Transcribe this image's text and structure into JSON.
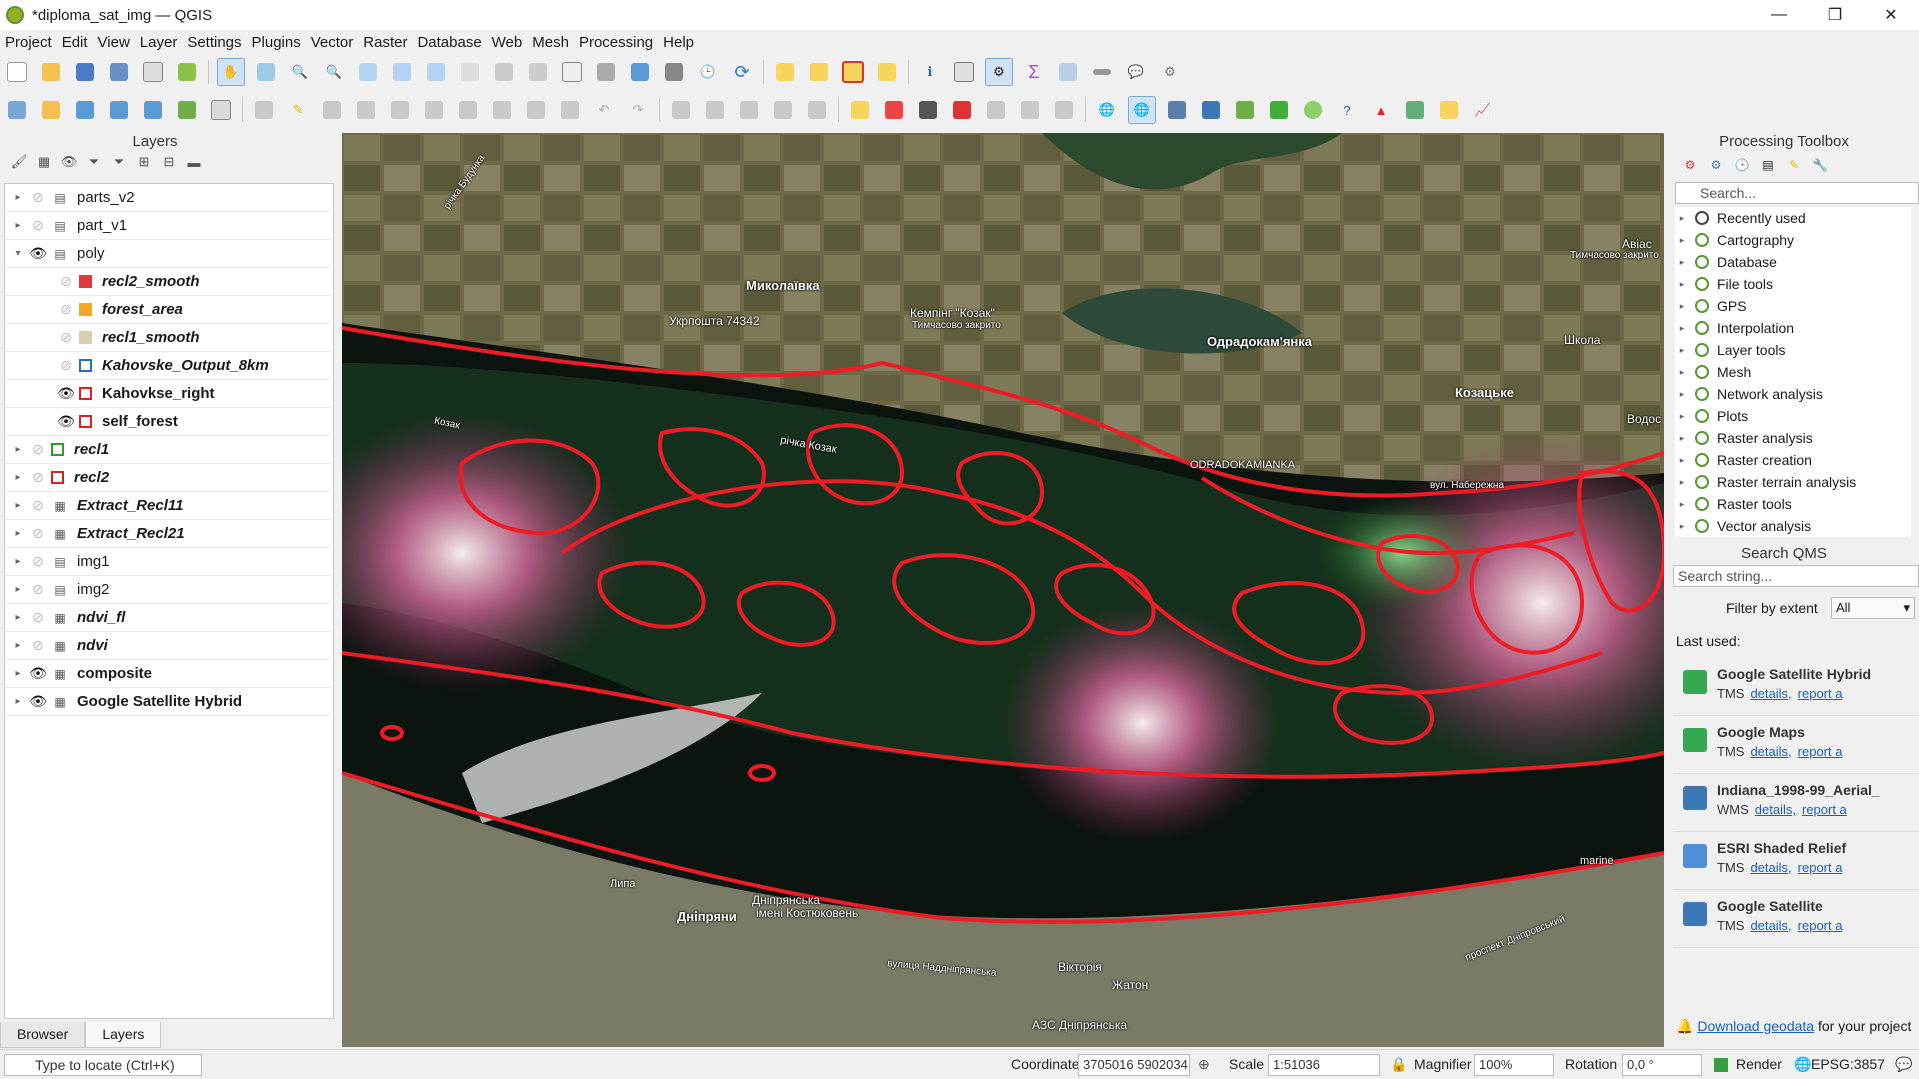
{
  "window": {
    "title": "*diploma_sat_img — QGIS"
  },
  "menu": [
    "Project",
    "Edit",
    "View",
    "Layer",
    "Settings",
    "Plugins",
    "Vector",
    "Raster",
    "Database",
    "Web",
    "Mesh",
    "Processing",
    "Help"
  ],
  "layers_panel": {
    "title": "Layers",
    "items": [
      {
        "name": "parts_v2",
        "visible": false,
        "style": "plain",
        "kind": "group"
      },
      {
        "name": "part_v1",
        "visible": false,
        "style": "plain",
        "kind": "group"
      },
      {
        "name": "poly",
        "visible": true,
        "style": "plain",
        "kind": "group"
      },
      {
        "name": "recl2_smooth",
        "visible": false,
        "style": "bi",
        "kind": "vector",
        "color": "#e03a3a",
        "fill": true
      },
      {
        "name": "forest_area",
        "visible": false,
        "style": "bi",
        "kind": "vector",
        "color": "#f5a623",
        "fill": true
      },
      {
        "name": "recl1_smooth",
        "visible": false,
        "style": "bi",
        "kind": "vector",
        "color": "#d9cfae",
        "fill": true
      },
      {
        "name": "Kahovske_Output_8km",
        "visible": false,
        "style": "bi",
        "kind": "vector",
        "color": "#2a6cc2",
        "fill": false
      },
      {
        "name": "Kahovkse_right",
        "visible": true,
        "style": "b",
        "kind": "vector",
        "color": "#e02020",
        "fill": false
      },
      {
        "name": "self_forest",
        "visible": true,
        "style": "b",
        "kind": "vector",
        "color": "#e02020",
        "fill": false
      },
      {
        "name": "recl1",
        "visible": false,
        "style": "bi",
        "kind": "vector",
        "color": "#2a9d2a",
        "fill": false
      },
      {
        "name": "recl2",
        "visible": false,
        "style": "bi",
        "kind": "vector",
        "color": "#d92020",
        "fill": false
      },
      {
        "name": "Extract_Recl11",
        "visible": false,
        "style": "bi",
        "kind": "raster"
      },
      {
        "name": "Extract_Recl21",
        "visible": false,
        "style": "bi",
        "kind": "raster"
      },
      {
        "name": "img1",
        "visible": false,
        "style": "plain",
        "kind": "group"
      },
      {
        "name": "img2",
        "visible": false,
        "style": "plain",
        "kind": "group"
      },
      {
        "name": "ndvi_fl",
        "visible": false,
        "style": "bi",
        "kind": "raster"
      },
      {
        "name": "ndvi",
        "visible": false,
        "style": "bi",
        "kind": "raster"
      },
      {
        "name": "composite",
        "visible": true,
        "style": "b",
        "kind": "raster"
      },
      {
        "name": "Google Satellite Hybrid",
        "visible": true,
        "style": "b",
        "kind": "raster"
      }
    ],
    "tabs": [
      "Browser",
      "Layers"
    ]
  },
  "map_labels": {
    "mykolaivka": "Миколаївка",
    "ukrposhta": "Укрпошта 74342",
    "kemping": "Кемпінг \"Козак\"",
    "kemping_sub": "Тимчасово закрито",
    "odradokamyanka": "Одрадокам'янка",
    "odradokamianka_en": "ODRADOKAMIANKA",
    "kozatske": "Козацьке",
    "shkola": "Школа",
    "aviac": "Авіас",
    "aviac_sub": "Тимчасово закрито",
    "vodos": "Водос",
    "naberezhna": "вул. Набережна",
    "kozak_river": "річка Козак",
    "kozak_river2": "Козак",
    "budynka": "річка Будунка",
    "dniprany": "Дніпряни",
    "dniprianska": "Дніпрянська",
    "kostyukovych": "імені Костюковень",
    "viktoria": "Вікторія",
    "zhaton": "Жатон",
    "azs": "АЗС Дніпрянська",
    "nadniprianska": "вулиця Наддніпрянська",
    "prospekt": "проспект Дніпровський",
    "marine": "marine",
    "lypa": "Липа"
  },
  "processing": {
    "title": "Processing Toolbox",
    "search_placeholder": "Search...",
    "items": [
      "Recently used",
      "Cartography",
      "Database",
      "File tools",
      "GPS",
      "Interpolation",
      "Layer tools",
      "Mesh",
      "Network analysis",
      "Plots",
      "Raster analysis",
      "Raster creation",
      "Raster terrain analysis",
      "Raster tools",
      "Vector analysis"
    ]
  },
  "qms": {
    "title": "Search QMS",
    "search_placeholder": "Search string...",
    "filter_label": "Filter by extent",
    "filter_value": "All",
    "last_used_label": "Last used:",
    "items": [
      {
        "name": "Google Satellite Hybrid",
        "type": "TMS",
        "icon": "google-maps-icon"
      },
      {
        "name": "Google Maps",
        "type": "TMS",
        "icon": "google-maps-icon"
      },
      {
        "name": "Indiana_1998-99_Aerial_",
        "type": "WMS",
        "icon": "map-icon"
      },
      {
        "name": "ESRI Shaded Relief",
        "type": "TMS",
        "icon": "relief-icon"
      },
      {
        "name": "Google Satellite",
        "type": "TMS",
        "icon": "map-icon"
      }
    ],
    "details_label": "details,",
    "report_label": "report a",
    "download_link": "Download geodata",
    "download_suffix": "for your project"
  },
  "statusbar": {
    "locate_placeholder": "Type to locate (Ctrl+K)",
    "coordinate_label": "Coordinate",
    "coordinate_value": "3705016 5902034",
    "scale_label": "Scale",
    "scale_value": "1:51036",
    "magnifier_label": "Magnifier",
    "magnifier_value": "100%",
    "rotation_label": "Rotation",
    "rotation_value": "0,0 °",
    "render_label": "Render",
    "crs": "EPSG:3857"
  }
}
